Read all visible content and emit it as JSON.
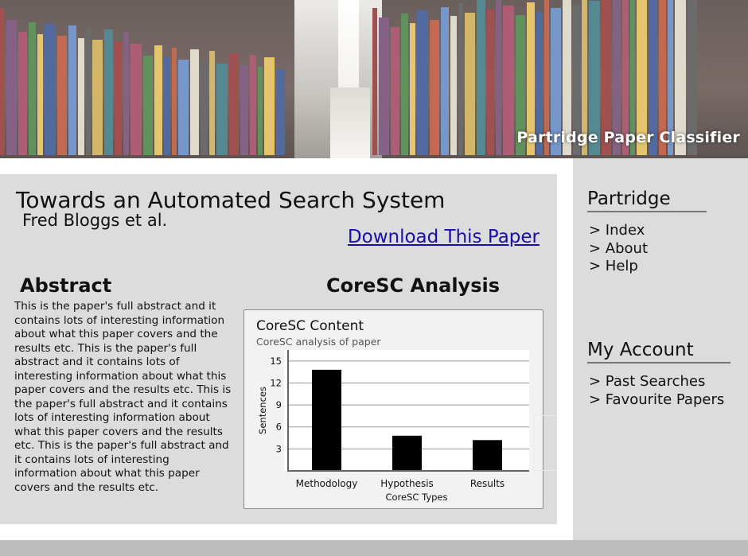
{
  "header": {
    "site_title": "Partridge Paper Classifier",
    "banner_image": "library-bookshelves-photo"
  },
  "paper": {
    "title": "Towards an Automated Search System",
    "authors": "Fred Bloggs et al.",
    "download_label": "Download This Paper"
  },
  "abstract": {
    "heading": "Abstract",
    "text": "This is the paper's full abstract and it contains lots of interesting information about what this paper covers and the results etc. This is the paper's full abstract and it contains lots of interesting information about what this paper covers and the results etc. This is the paper's full abstract and it contains lots of interesting information about what this paper covers and the results etc. This is the paper's full abstract and it contains lots of interesting information about what this paper covers and the results etc."
  },
  "analysis": {
    "heading": "CoreSC Analysis"
  },
  "chart_data": {
    "type": "bar",
    "title": "CoreSC Content",
    "subtitle": "CoreSC analysis of paper",
    "categories": [
      "Methodology",
      "Hypothesis",
      "Results"
    ],
    "values": [
      13.8,
      4.8,
      4.2
    ],
    "xlabel": "CoreSC Types",
    "ylabel": "Sentences",
    "yticks": [
      3,
      6,
      9,
      12,
      15
    ],
    "ylim": [
      0,
      16.5
    ],
    "grid": true,
    "legend": "none",
    "bar_color": "#000000"
  },
  "sidebar": {
    "section1": {
      "heading": "Partridge",
      "links": [
        "> Index",
        "> About",
        "> Help"
      ]
    },
    "section2": {
      "heading": "My Account",
      "links": [
        "> Past Searches",
        "> Favourite Papers"
      ]
    }
  },
  "colors": {
    "panel": "#dcdcdc",
    "link": "#1a0dab",
    "footer": "#bdbdbd"
  }
}
